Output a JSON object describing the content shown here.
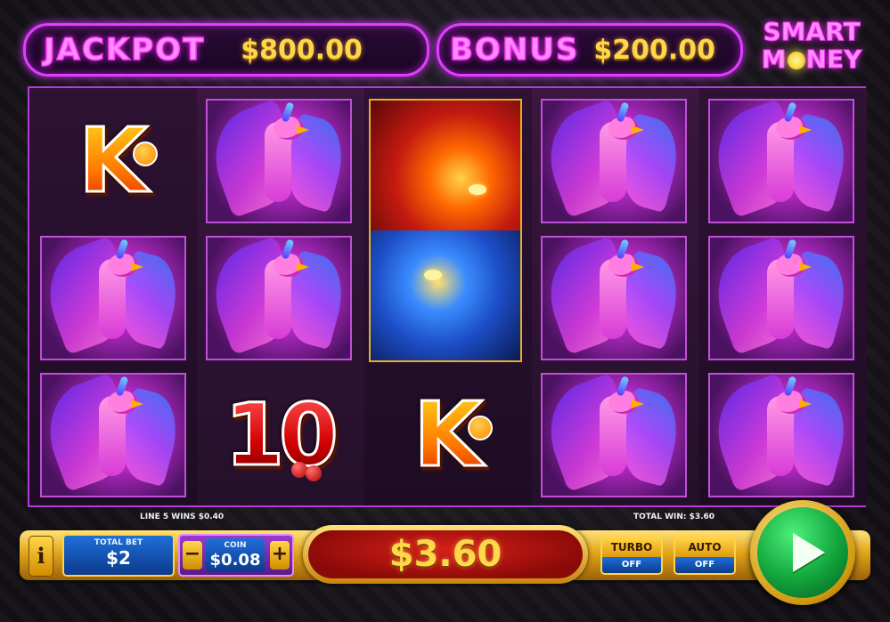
{
  "header": {
    "jackpot_label": "JACKPOT",
    "jackpot_value": "$800.00",
    "bonus_label": "BONUS",
    "bonus_value": "$200.00",
    "logo_line1": "SMART",
    "logo_line2a": "M",
    "logo_line2b": "NEY"
  },
  "reels": {
    "columns": [
      [
        "K",
        "phoenix",
        "phoenix"
      ],
      [
        "phoenix",
        "phoenix",
        "10"
      ],
      [
        "dragon",
        "dragon",
        "K"
      ],
      [
        "phoenix",
        "phoenix",
        "phoenix"
      ],
      [
        "phoenix",
        "phoenix",
        "phoenix"
      ]
    ],
    "symbol_k": "K",
    "symbol_10": "10"
  },
  "status": {
    "line_win": "LINE 5 WINS $0.40",
    "total_win": "TOTAL WIN: $3.60"
  },
  "controls": {
    "info_label": "i",
    "total_bet_caption": "TOTAL BET",
    "total_bet_value": "$2",
    "coin_caption": "COIN",
    "coin_value": "$0.08",
    "minus_label": "−",
    "plus_label": "+",
    "win_amount": "$3.60",
    "turbo_label": "TURBO",
    "turbo_state": "OFF",
    "auto_label": "AUTO",
    "auto_state": "OFF",
    "spin_icon": "play-triangle"
  },
  "colors": {
    "neon": "#e23cff",
    "gold": "#ffd54a",
    "spin_green": "#11a33c"
  }
}
